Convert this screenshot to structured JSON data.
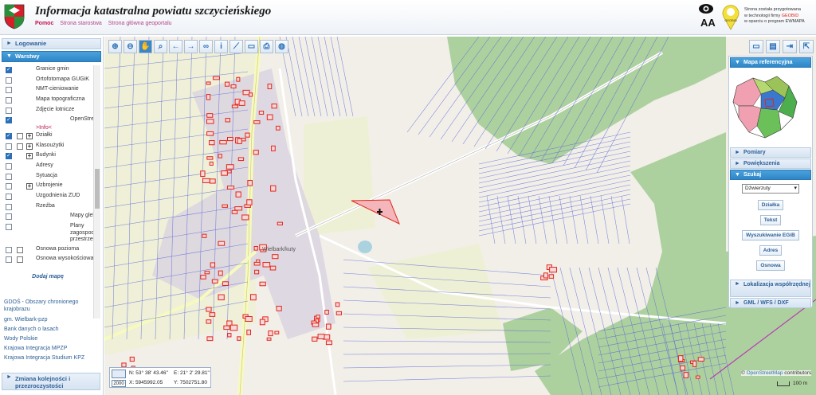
{
  "header": {
    "title": "Informacja katastralna powiatu szczycieńskiego",
    "links": [
      "Pomoc",
      "Strona starostwa",
      "Strona główna geoportalu"
    ],
    "font_aa": "AA",
    "brand": "GEOBID",
    "credit_line1": "Strona została przygotowana",
    "credit_line2_pre": "w technologii firmy ",
    "credit_line2_brand": "GEOBID",
    "credit_line3": "w oparciu o program EWMAPA"
  },
  "sidebar": {
    "logowanie": "Logowanie",
    "warstwy": "Warstwy",
    "layers": [
      {
        "label": "Granice gmin",
        "checked": true
      },
      {
        "label": "Ortofotomapa GUGiK",
        "checked": false
      },
      {
        "label": "NMT-cieniowanie",
        "checked": false
      },
      {
        "label": "Mapa topograficzna",
        "checked": false
      },
      {
        "label": "Zdjęcie lotnicze",
        "checked": false
      },
      {
        "label": "OpenStreetMap",
        "checked": true,
        "info": ">Info<"
      },
      {
        "label": "Działki",
        "checked": true,
        "legend": true,
        "expand": true
      },
      {
        "label": "Klasoużytki",
        "checked": false,
        "legend": true,
        "expand": true
      },
      {
        "label": "Budynki",
        "checked": true,
        "expand": true
      },
      {
        "label": "Adresy",
        "checked": false
      },
      {
        "label": "Sytuacja",
        "checked": false
      },
      {
        "label": "Uzbrojenie",
        "checked": false,
        "expand": true
      },
      {
        "label": "Uzgodnienia ZUD",
        "checked": false
      },
      {
        "label": "Rzeźba",
        "checked": false
      },
      {
        "label": "Mapy glebowo-rolnicze",
        "checked": false
      },
      {
        "label": "Plany zagospodarowania przestrzennego",
        "checked": false
      },
      {
        "label": "Osnowa pozioma",
        "checked": false,
        "legend": true
      },
      {
        "label": "Osnowa wysokościowa",
        "checked": false,
        "legend": true
      }
    ],
    "add_map": "Dodaj mapę",
    "extra_maps": [
      "GDOŚ - Obszary chronionego krajobrazu",
      "gm. Wielbark-pzp",
      "Bank danych o lasach",
      "Wody Polskie",
      "Krajowa Integracja MPZP",
      "Krajowa Integracja Studium KPZ"
    ],
    "order_panel": "Zmiana kolejności i przezroczystości"
  },
  "toolbar": {
    "tools": [
      "zoom-in",
      "zoom-out",
      "pan",
      "zoom-box",
      "back",
      "forward",
      "link",
      "info",
      "measure",
      "ruler",
      "print",
      "globe"
    ]
  },
  "right_panel": {
    "reference_map": "Mapa referencyjna",
    "pomiary": "Pomiary",
    "powiekszenia": "Powiększenia",
    "szukaj": "Szukaj",
    "search_select": "Dźwierzuty",
    "buttons": [
      "Działka",
      "Tekst",
      "Wyszukiwanie EGiB",
      "Adres",
      "Osnowa"
    ],
    "lokalizacja": "Lokalizacja współrzędnej",
    "gml": "GML / WFS / DXF"
  },
  "map": {
    "village_label": "Wielbark/kuty",
    "scale_denominator": "2000",
    "coord_n": "N: 53° 38' 43.46\"",
    "coord_e": "E: 21° 2' 29.81\"",
    "coord_x": "X: 5945992.05",
    "coord_y": "Y: 7502751.80",
    "attribution_prefix": "© ",
    "attribution_osm": "OpenStreetMap",
    "attribution_suffix": " contributors",
    "scale_label": "100 m"
  },
  "colors": {
    "accent": "#2f86c8",
    "forest": "#add19e",
    "farmland": "#eef0d5",
    "residential": "#dad4e0",
    "building": "#e0251b",
    "parcel_line": "#5a67d8"
  }
}
